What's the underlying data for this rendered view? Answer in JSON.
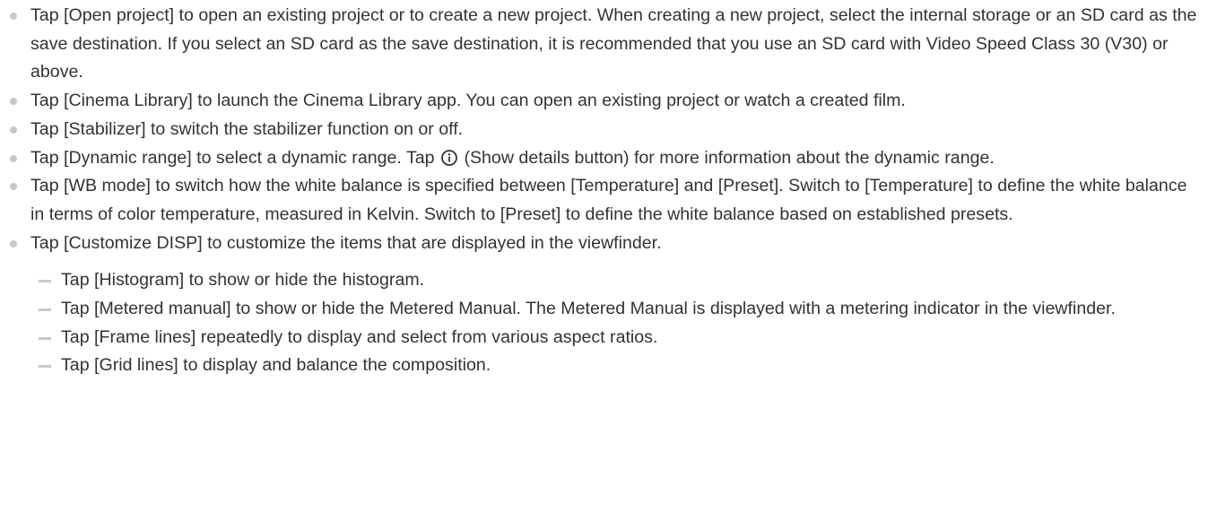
{
  "items": [
    "Tap [Open project] to open an existing project or to create a new project. When creating a new project, select the internal storage or an SD card as the save destination. If you select an SD card as the save destination, it is recommended that you use an SD card with Video Speed Class 30 (V30) or above.",
    "Tap [Cinema Library] to launch the Cinema Library app. You can open an existing project or watch a created film.",
    "Tap [Stabilizer] to switch the stabilizer function on or off.",
    {
      "before_icon": "Tap [Dynamic range] to select a dynamic range. Tap",
      "icon": "info-circle-icon",
      "after_icon": "(Show details button) for more information about the dynamic range."
    },
    "Tap [WB mode] to switch how the white balance is specified between [Temperature] and [Preset]. Switch to [Temperature] to define the white balance in terms of color temperature, measured in Kelvin. Switch to [Preset] to define the white balance based on established presets.",
    "Tap [Customize DISP] to customize the items that are displayed in the viewfinder."
  ],
  "sub_items": [
    "Tap [Histogram] to show or hide the histogram.",
    "Tap [Metered manual] to show or hide the Metered Manual. The Metered Manual is displayed with a metering indicator in the viewfinder.",
    "Tap [Frame lines] repeatedly to display and select from various aspect ratios.",
    "Tap [Grid lines] to display and balance the composition."
  ]
}
